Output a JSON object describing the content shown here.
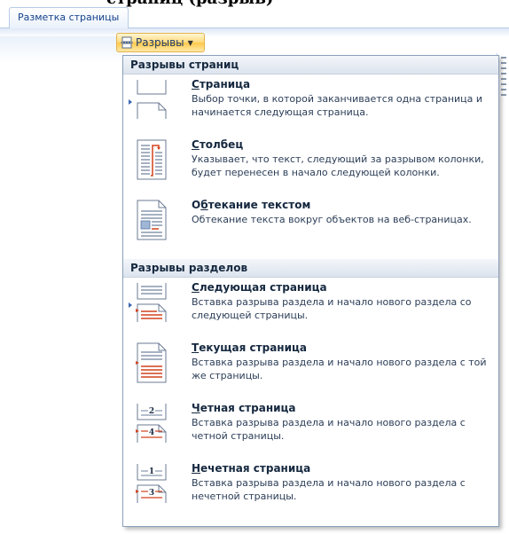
{
  "page_title": "страниц (разрыв)",
  "ribbon": {
    "tab_label": "Разметка страницы",
    "breaks_button_label": "Разрывы"
  },
  "menu": {
    "page_breaks_header": "Разрывы страниц",
    "section_breaks_header": "Разрывы разделов",
    "page_break_items": [
      {
        "accel": "С",
        "rest": "траница",
        "description": "Выбор точки, в которой заканчивается одна страница и начинается следующая страница.",
        "icon": "page-break-icon"
      },
      {
        "accel": "С",
        "rest": "толбец",
        "description": "Указывает, что текст, следующий за разрывом колонки, будет перенесен в начало следующей колонки.",
        "icon": "column-break-icon"
      },
      {
        "pre": "О",
        "accel": "б",
        "rest": "текание текстом",
        "description": "Обтекание текста вокруг объектов на веб-страницах.",
        "icon": "text-wrapping-icon"
      }
    ],
    "section_break_items": [
      {
        "accel": "С",
        "rest": "ледующая страница",
        "description": "Вставка разрыва раздела и начало нового раздела со следующей страницы.",
        "icon": "next-page-section-icon"
      },
      {
        "accel": "Т",
        "rest": "екущая страница",
        "description": "Вставка разрыва раздела и начало нового раздела с той же страницы.",
        "icon": "continuous-section-icon"
      },
      {
        "accel": "Ч",
        "rest": "етная страница",
        "description": "Вставка разрыва раздела и начало нового раздела с четной страницы.",
        "icon": "even-page-section-icon",
        "icon_numbers": [
          "2",
          "4"
        ]
      },
      {
        "accel": "Н",
        "rest": "ечетная страница",
        "description": "Вставка разрыва раздела и начало нового раздела с нечетной страницы.",
        "icon": "odd-page-section-icon",
        "icon_numbers": [
          "1",
          "3"
        ]
      }
    ]
  },
  "colors": {
    "accent_red": "#d2421f",
    "menu_text": "#15283f",
    "header_blue": "#15428b"
  }
}
